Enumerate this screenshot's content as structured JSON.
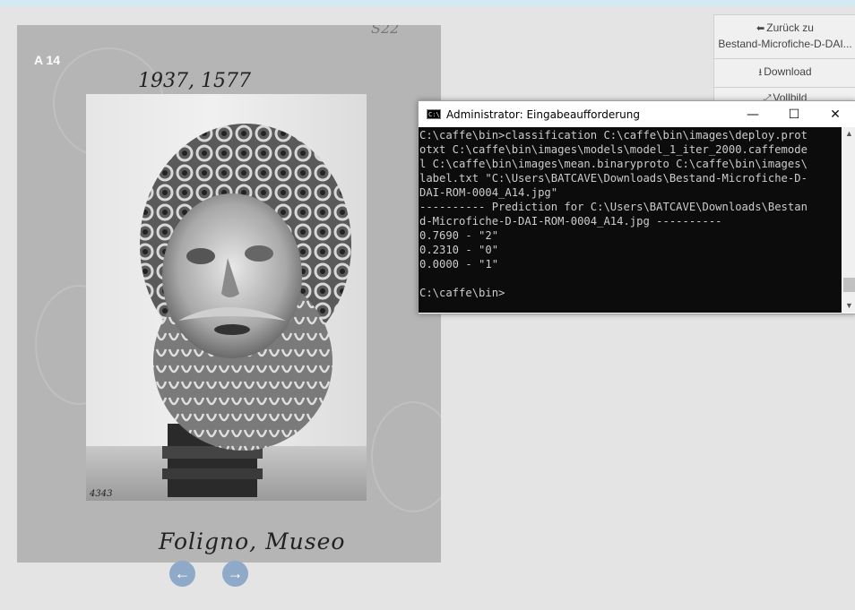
{
  "viewer": {
    "label": "A 14",
    "handwritten_number": "1937, 1577",
    "plate_number": "4343",
    "caption": "Foligno, Museo",
    "corner_mark": "S22",
    "prev_icon": "arrow-left-icon",
    "next_icon": "arrow-right-icon"
  },
  "panel": {
    "back_label_1": "Zurück zu",
    "back_label_2": "Bestand-Microfiche-D-DAI...",
    "download_label": "Download",
    "fullscreen_label": "Vollbild"
  },
  "console": {
    "title": "Administrator: Eingabeaufforderung",
    "lines": [
      "C:\\caffe\\bin>classification C:\\caffe\\bin\\images\\deploy.prot",
      "otxt C:\\caffe\\bin\\images\\models\\model_1_iter_2000.caffemode",
      "l C:\\caffe\\bin\\images\\mean.binaryproto C:\\caffe\\bin\\images\\",
      "label.txt \"C:\\Users\\BATCAVE\\Downloads\\Bestand-Microfiche-D-",
      "DAI-ROM-0004_A14.jpg\"",
      "---------- Prediction for C:\\Users\\BATCAVE\\Downloads\\Bestan",
      "d-Microfiche-D-DAI-ROM-0004_A14.jpg ----------",
      "0.7690 - \"2\"",
      "0.2310 - \"0\"",
      "0.0000 - \"1\"",
      "",
      "C:\\caffe\\bin>"
    ]
  },
  "colors": {
    "topbar": "#d3e9f3",
    "nav_button": "#8fa9c9",
    "console_bg": "#0c0c0c",
    "console_text": "#cccccc"
  }
}
